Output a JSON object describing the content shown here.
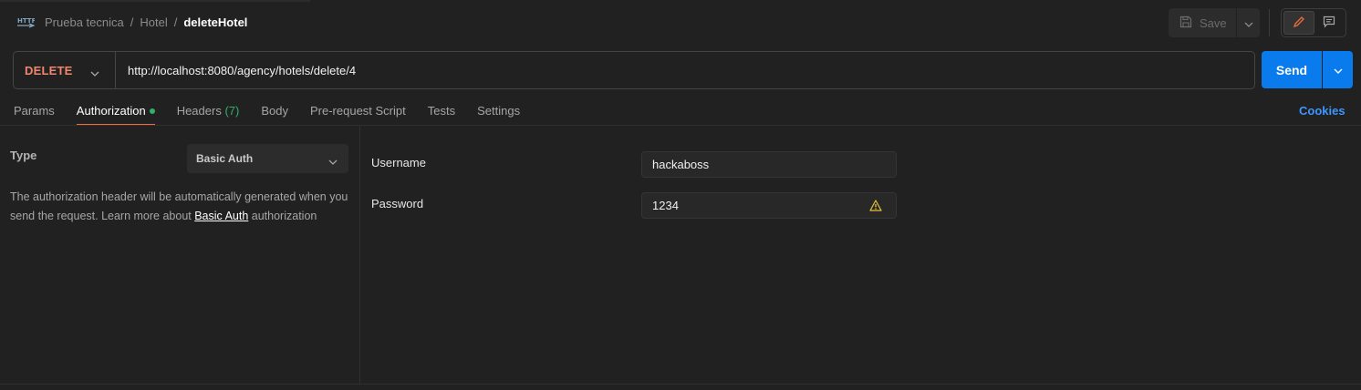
{
  "breadcrumb": {
    "icon": "http-request-icon",
    "items": [
      "Prueba tecnica",
      "Hotel"
    ],
    "separator": "/",
    "current": "deleteHotel"
  },
  "toolbar": {
    "save_label": "Save",
    "save_icon": "floppy-disk-icon",
    "edit_icon": "pencil-icon",
    "comments_icon": "comment-icon"
  },
  "request": {
    "method": "DELETE",
    "url": "http://localhost:8080/agency/hotels/delete/4",
    "send_label": "Send"
  },
  "tabs": [
    {
      "label": "Params"
    },
    {
      "label": "Authorization",
      "dot": true
    },
    {
      "label": "Headers",
      "count": "(7)"
    },
    {
      "label": "Body"
    },
    {
      "label": "Pre-request Script"
    },
    {
      "label": "Tests"
    },
    {
      "label": "Settings"
    }
  ],
  "active_tab": "Authorization",
  "cookies_label": "Cookies",
  "auth": {
    "type_label": "Type",
    "type_value": "Basic Auth",
    "description_prefix": "The authorization header will be automatically generated when you send the request. Learn more about ",
    "description_link": "Basic Auth",
    "description_suffix": " authorization",
    "username_label": "Username",
    "username_value": "hackaboss",
    "password_label": "Password",
    "password_value": "1234",
    "password_warning_icon": "warning-triangle-icon"
  },
  "colors": {
    "background": "#212121",
    "method_delete": "#f0866b",
    "send_button": "#097bed",
    "active_tab_underline": "#f26b3a",
    "status_green": "#2fb06b",
    "link_blue": "#3d96ff",
    "warning_yellow": "#e5c23a"
  }
}
